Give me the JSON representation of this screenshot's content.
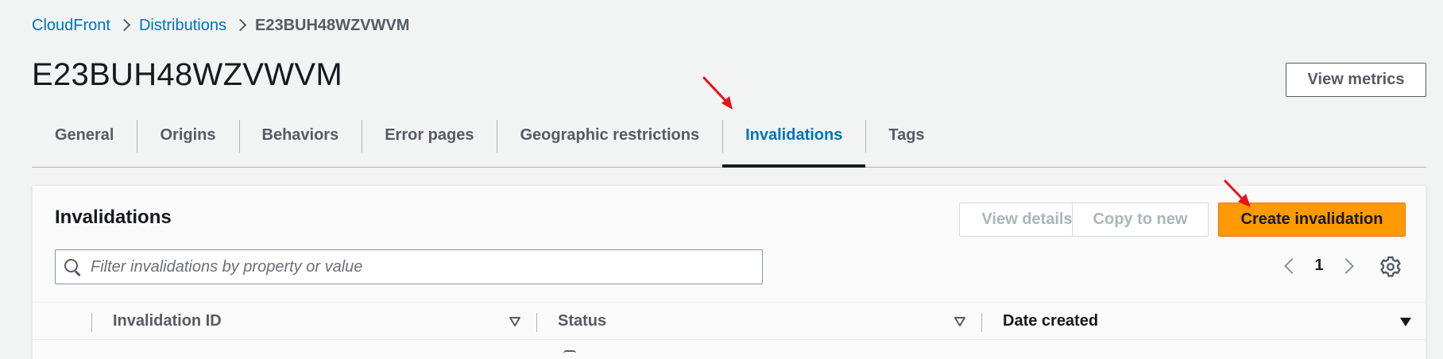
{
  "breadcrumb": {
    "items": [
      "CloudFront",
      "Distributions"
    ],
    "current": "E23BUH48WZVWVM"
  },
  "page": {
    "title": "E23BUH48WZVWVM",
    "view_metrics_label": "View metrics"
  },
  "tabs": [
    {
      "label": "General"
    },
    {
      "label": "Origins"
    },
    {
      "label": "Behaviors"
    },
    {
      "label": "Error pages"
    },
    {
      "label": "Geographic restrictions"
    },
    {
      "label": "Invalidations",
      "active": true
    },
    {
      "label": "Tags"
    }
  ],
  "invalidations": {
    "title": "Invalidations",
    "view_details_label": "View details",
    "copy_to_new_label": "Copy to new",
    "create_label": "Create invalidation",
    "search_placeholder": "Filter invalidations by property or value",
    "page_number": "1",
    "columns": [
      "Invalidation ID",
      "Status",
      "Date created"
    ]
  },
  "colors": {
    "link": "#0073bb",
    "primary_button": "#ff9900",
    "annotation_arrow": "#e8131a"
  },
  "icons": [
    "chevron-right-icon",
    "search-icon",
    "chevron-left-icon",
    "settings-gear-icon",
    "sort-outline-icon",
    "sort-descending-icon",
    "red-arrow-annotation"
  ]
}
